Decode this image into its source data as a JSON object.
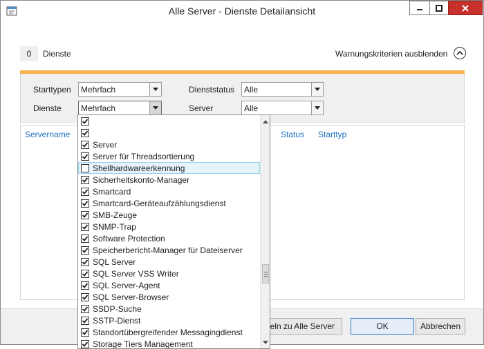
{
  "window": {
    "title": "Alle Server - Dienste Detailansicht"
  },
  "header": {
    "service_count": "0",
    "services_label": "Dienste",
    "toggle_warnings_label": "Warnungskriterien ausblenden"
  },
  "filters": {
    "starttypen_label": "Starttypen",
    "starttypen_value": "Mehrfach",
    "dienste_label": "Dienste",
    "dienste_value": "Mehrfach",
    "dienststatus_label": "Dienststatus",
    "dienststatus_value": "Alle",
    "server_label": "Server",
    "server_value": "Alle"
  },
  "grid": {
    "columns": [
      "Servername",
      "Status",
      "Starttyp"
    ]
  },
  "dropdown": {
    "items": [
      {
        "label": "",
        "checked": true
      },
      {
        "label": "",
        "checked": true
      },
      {
        "label": "Server",
        "checked": true
      },
      {
        "label": "Server für Threadsortierung",
        "checked": true
      },
      {
        "label": "Shellhardwareerkennung",
        "checked": false,
        "highlighted": true
      },
      {
        "label": "Sicherheitskonto-Manager",
        "checked": true
      },
      {
        "label": "Smartcard",
        "checked": true
      },
      {
        "label": "Smartcard-Geräteaufzählungsdienst",
        "checked": true
      },
      {
        "label": "SMB-Zeuge",
        "checked": true
      },
      {
        "label": "SNMP-Trap",
        "checked": true
      },
      {
        "label": "Software Protection",
        "checked": true
      },
      {
        "label": "Speicherbericht-Manager für Dateiserver",
        "checked": true
      },
      {
        "label": "SQL Server",
        "checked": true
      },
      {
        "label": "SQL Server VSS Writer",
        "checked": true
      },
      {
        "label": "SQL Server-Agent",
        "checked": true
      },
      {
        "label": "SQL Server-Browser",
        "checked": true
      },
      {
        "label": "SSDP-Suche",
        "checked": true
      },
      {
        "label": "SSTP-Dienst",
        "checked": true
      },
      {
        "label": "Standortübergreifender Messagingdienst",
        "checked": true
      },
      {
        "label": "Storage Tiers Management",
        "checked": true
      }
    ]
  },
  "footer": {
    "apply_all_label": "...eln zu Alle Server",
    "apply_all_visible": "eln zu Alle Server",
    "ok_label": "OK",
    "cancel_label": "Abbrechen"
  }
}
